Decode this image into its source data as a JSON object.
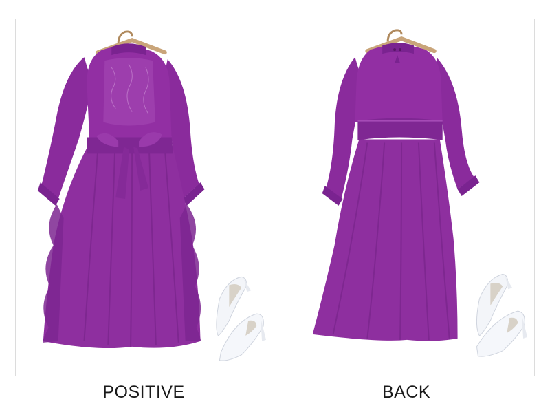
{
  "captions": {
    "front": "POSITIVE",
    "back": "BACK"
  },
  "colors": {
    "dress": "#8e2f9f",
    "dress_dark": "#6b1e7e",
    "dress_light": "#a94bb9",
    "shoe": "#f4f6fa",
    "hanger": "#c9a57a",
    "border": "#dcdcdc"
  },
  "images": [
    {
      "name": "front-view-photo",
      "subject": "purple-chiffon-dress-front-with-white-heels"
    },
    {
      "name": "back-view-photo",
      "subject": "purple-chiffon-dress-back-with-white-heels"
    }
  ]
}
